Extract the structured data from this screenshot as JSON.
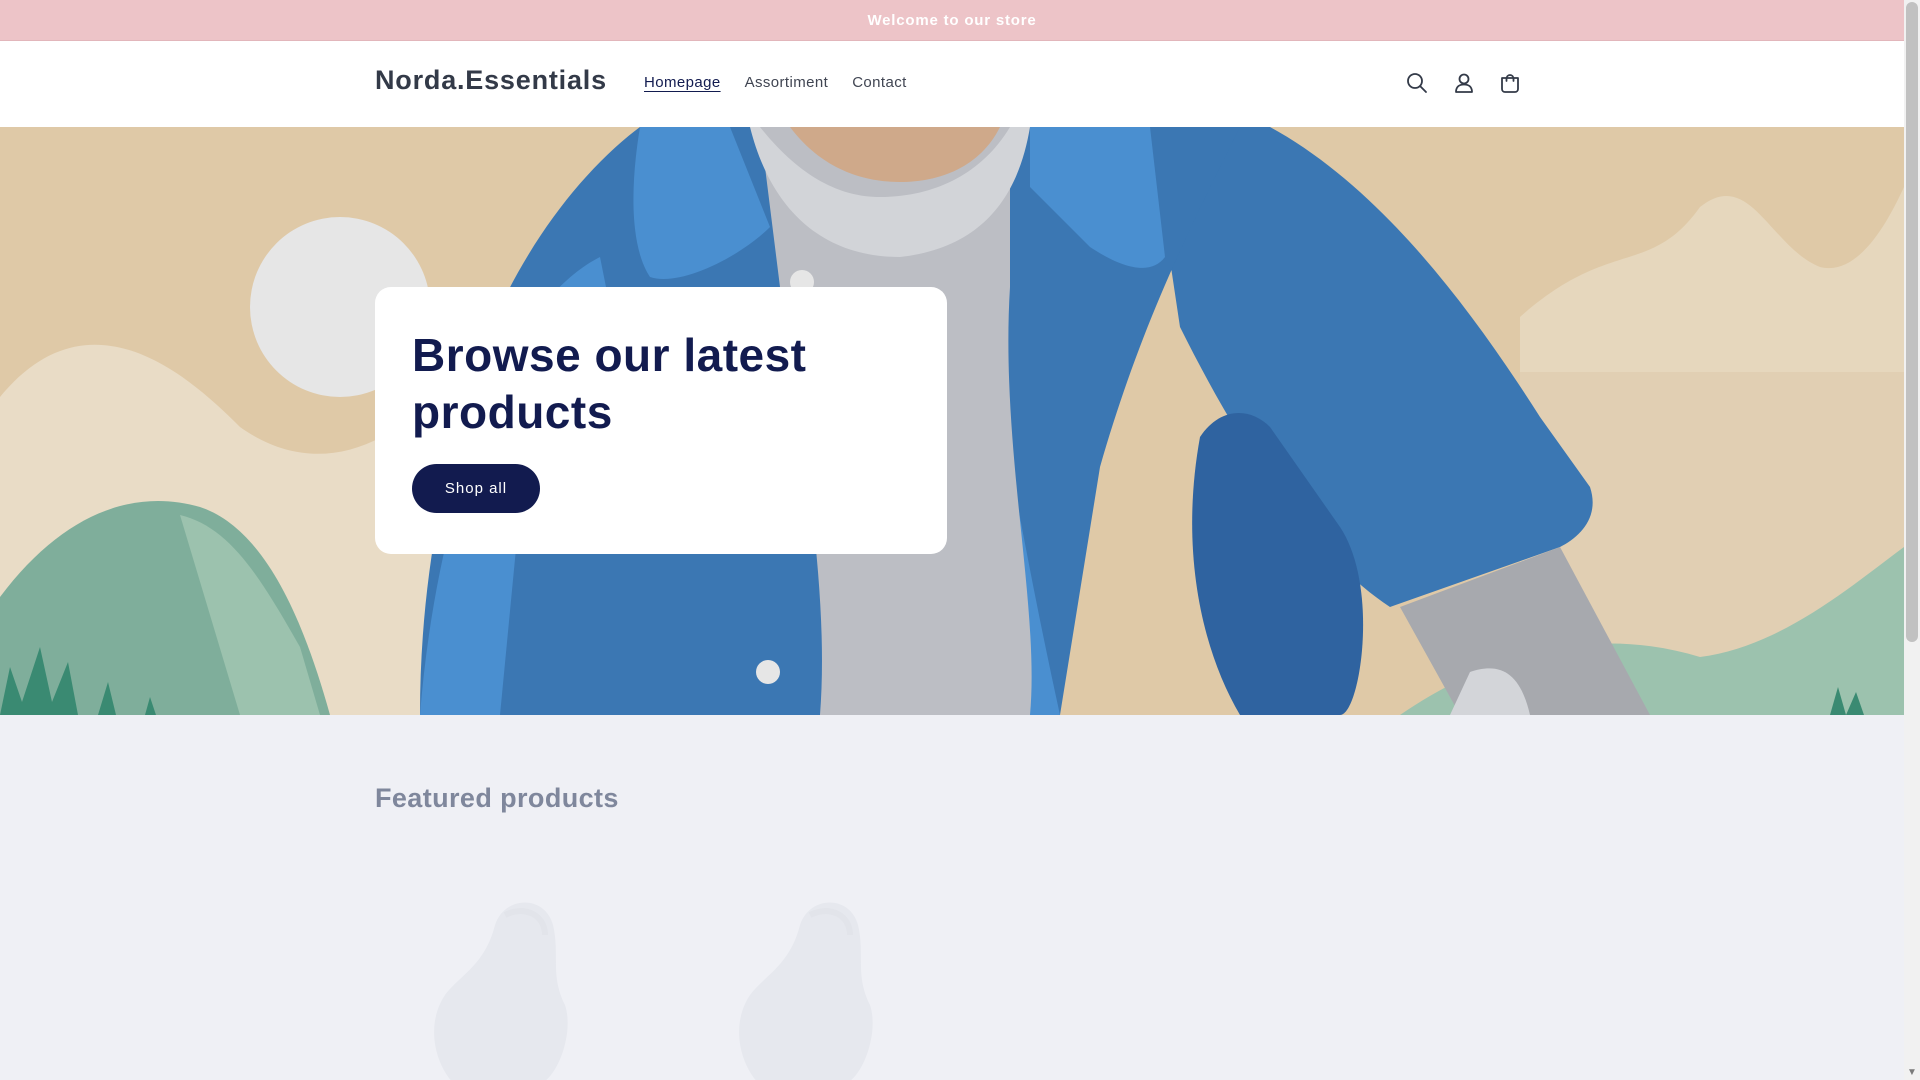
{
  "announcement": {
    "text": "Welcome to our store"
  },
  "header": {
    "logo": "Norda.Essentials",
    "nav": [
      {
        "label": "Homepage",
        "active": true
      },
      {
        "label": "Assortiment",
        "active": false
      },
      {
        "label": "Contact",
        "active": false
      }
    ],
    "icons": [
      "search-icon",
      "account-icon",
      "cart-icon"
    ]
  },
  "hero": {
    "title": "Browse our latest products",
    "button_label": "Shop all"
  },
  "featured": {
    "title": "Featured products"
  },
  "colors": {
    "announcement_bg": "#edc4c8",
    "brand_navy": "#121b4f",
    "hero_bg": "#dfc9a7",
    "jacket_blue": "#3b77b3",
    "page_bg": "#eff0f5"
  }
}
